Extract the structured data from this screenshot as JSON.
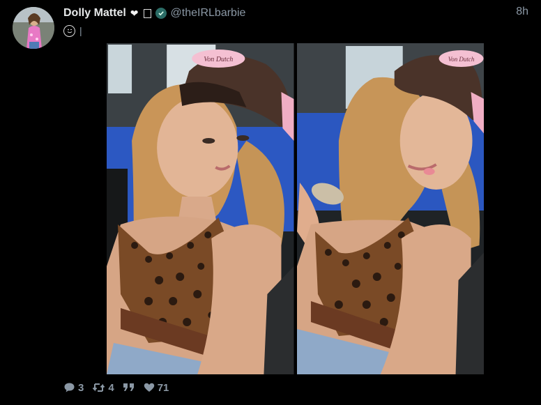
{
  "tweet": {
    "display_name": "Dolly Mattel",
    "name_emoji": "❤",
    "handle": "@theIRLbarbie",
    "time": "8h",
    "text": "|",
    "text_emoji": "winking-tongue-face",
    "verified": true
  },
  "media": {
    "count": 2,
    "hat_text": [
      "Von Dutch",
      "Von Dutch"
    ]
  },
  "actions": {
    "replies": "3",
    "retweets": "4",
    "quote_label": "””",
    "likes": "71"
  },
  "colors": {
    "background": "#000000",
    "text_primary": "#e7e9ea",
    "text_secondary": "#8b98a5",
    "verified_badge": "#2b6c66"
  }
}
